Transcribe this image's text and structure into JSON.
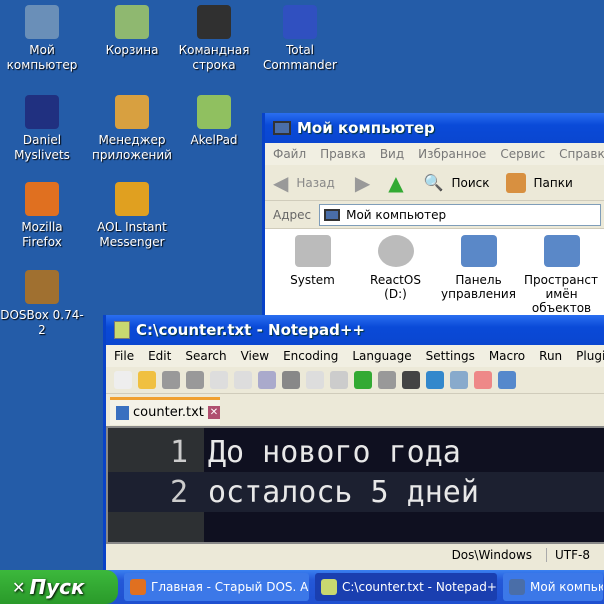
{
  "desktop": {
    "icons": [
      {
        "label": "Мой компьютер",
        "icon": "computer-icon",
        "color": "#6a8fb8"
      },
      {
        "label": "Корзина",
        "icon": "recycle-bin-icon",
        "color": "#8fb870"
      },
      {
        "label": "Командная строка",
        "icon": "console-icon",
        "color": "#303030"
      },
      {
        "label": "Total Commander",
        "icon": "floppy-icon",
        "color": "#3050c0"
      },
      {
        "label": "Daniel Myslivets",
        "icon": "dm-logo-icon",
        "color": "#203080"
      },
      {
        "label": "Менеджер приложений",
        "icon": "package-icon",
        "color": "#d8a040"
      },
      {
        "label": "AkelPad",
        "icon": "notepad-icon",
        "color": "#90c060"
      },
      {
        "label": "Mozilla Firefox",
        "icon": "firefox-icon",
        "color": "#e07020"
      },
      {
        "label": "AOL Instant Messenger",
        "icon": "aim-icon",
        "color": "#e0a020"
      },
      {
        "label": "DOSBox 0.74-2",
        "icon": "dosbox-icon",
        "color": "#a07030"
      }
    ]
  },
  "explorer": {
    "title": "Мой компьютер",
    "menu": [
      "Файл",
      "Правка",
      "Вид",
      "Избранное",
      "Сервис",
      "Справка"
    ],
    "toolbar": {
      "back": "Назад",
      "search": "Поиск",
      "folders": "Папки"
    },
    "address_label": "Адрес",
    "address": "Мой компьютер",
    "items": [
      "System",
      "ReactOS (D:)",
      "Панель управления",
      "Пространство имён объектов"
    ]
  },
  "notepad": {
    "title": "C:\\counter.txt - Notepad++",
    "menu": [
      "File",
      "Edit",
      "Search",
      "View",
      "Encoding",
      "Language",
      "Settings",
      "Macro",
      "Run",
      "Plugins"
    ],
    "tab": "counter.txt",
    "lines": [
      {
        "num": "1",
        "text": "До нового года"
      },
      {
        "num": "2",
        "text": "осталось 5 дней"
      }
    ],
    "status": {
      "eol": "Dos\\Windows",
      "encoding": "UTF-8"
    }
  },
  "taskbar": {
    "start": "Пуск",
    "tasks": [
      "Главная - Старый DOS. А...",
      "C:\\counter.txt - Notepad++",
      "Мой компьютер"
    ]
  }
}
